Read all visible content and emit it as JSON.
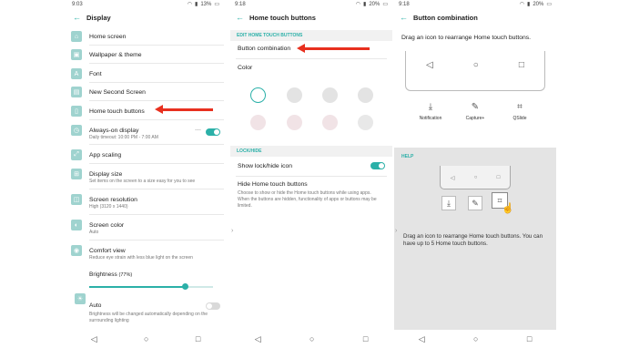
{
  "screen1": {
    "status": {
      "time": "9:03",
      "battery": "13%"
    },
    "title": "Display",
    "items": [
      {
        "label": "Home screen",
        "icon": "home-icon"
      },
      {
        "label": "Wallpaper & theme",
        "icon": "wallpaper-icon"
      },
      {
        "label": "Font",
        "icon": "font-icon"
      },
      {
        "label": "New Second Screen",
        "icon": "second-screen-icon"
      },
      {
        "label": "Home touch buttons",
        "icon": "touch-buttons-icon"
      },
      {
        "label": "Always-on display",
        "sub": "Daily timeout: 10:00 PM - 7:00 AM",
        "icon": "clock-icon"
      },
      {
        "label": "App scaling",
        "icon": "scaling-icon"
      },
      {
        "label": "Display size",
        "sub": "Set items on the screen to a size easy for you to see",
        "icon": "size-icon"
      },
      {
        "label": "Screen resolution",
        "sub": "High (3120 x 1440)",
        "icon": "resolution-icon"
      },
      {
        "label": "Screen color",
        "sub": "Auto",
        "icon": "color-icon"
      },
      {
        "label": "Comfort view",
        "sub": "Reduce eye strain with less blue light on the screen",
        "icon": "eye-icon"
      }
    ],
    "brightness_label": "Brightness",
    "brightness_value": "(77%)",
    "brightness_level": 0.77,
    "auto_label": "Auto",
    "auto_sub": "Brightness will be changed automatically depending on the surrounding lighting"
  },
  "screen2": {
    "status": {
      "time": "9:18",
      "battery": "20%"
    },
    "title": "Home touch buttons",
    "section1": "EDIT HOME TOUCH BUTTONS",
    "button_combination": "Button combination",
    "color": "Color",
    "section2": "LOCK/HIDE",
    "show_lock": "Show lock/hide icon",
    "hide_title": "Hide Home touch buttons",
    "hide_sub": "Choose to show or hide the Home touch buttons while using apps. When the buttons are hidden, functionality of apps or buttons may be limited.",
    "swatches": [
      "#ffffff",
      "#e3e3e3",
      "#e3e3e3",
      "#e3e3e3",
      "#f1e3e6",
      "#f1e3e6",
      "#f1e3e6",
      "#e8e8e8"
    ]
  },
  "screen3": {
    "status": {
      "time": "9:18",
      "battery": "20%"
    },
    "title": "Button combination",
    "instruction": "Drag an icon to rearrange Home touch buttons.",
    "available": [
      {
        "label": "Notification",
        "icon": "notification-icon"
      },
      {
        "label": "Capture+",
        "icon": "capture-icon"
      },
      {
        "label": "QSlide",
        "icon": "qslide-icon"
      }
    ],
    "help_label": "HELP",
    "help_text": "Drag an icon to rearrange Home touch buttons. You can have up to 5 Home touch buttons."
  },
  "accent": "#2bb0a8",
  "arrow_color": "#e8301f"
}
